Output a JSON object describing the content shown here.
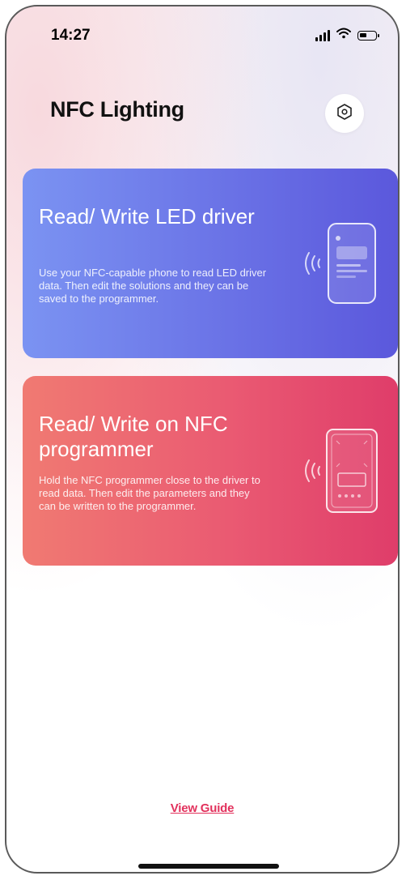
{
  "status_bar": {
    "time": "14:27"
  },
  "header": {
    "title": "NFC Lighting",
    "settings_icon": "hexagon-settings-icon"
  },
  "cards": [
    {
      "title": "Read/ Write LED driver",
      "description": "Use your NFC-capable phone to read LED driver data. Then edit the solutions and they can be saved to the programmer.",
      "icon": "phone-nfc-icon",
      "gradient": [
        "#7b93f2",
        "#5b58dc"
      ]
    },
    {
      "title": "Read/ Write on NFC programmer",
      "description": "Hold the NFC programmer close to the driver to read data. Then edit the parameters and they can be written to the programmer.",
      "icon": "programmer-nfc-icon",
      "gradient": [
        "#f07a72",
        "#df3d6a"
      ]
    }
  ],
  "footer": {
    "view_guide": "View Guide",
    "link_color": "#e2315c"
  }
}
